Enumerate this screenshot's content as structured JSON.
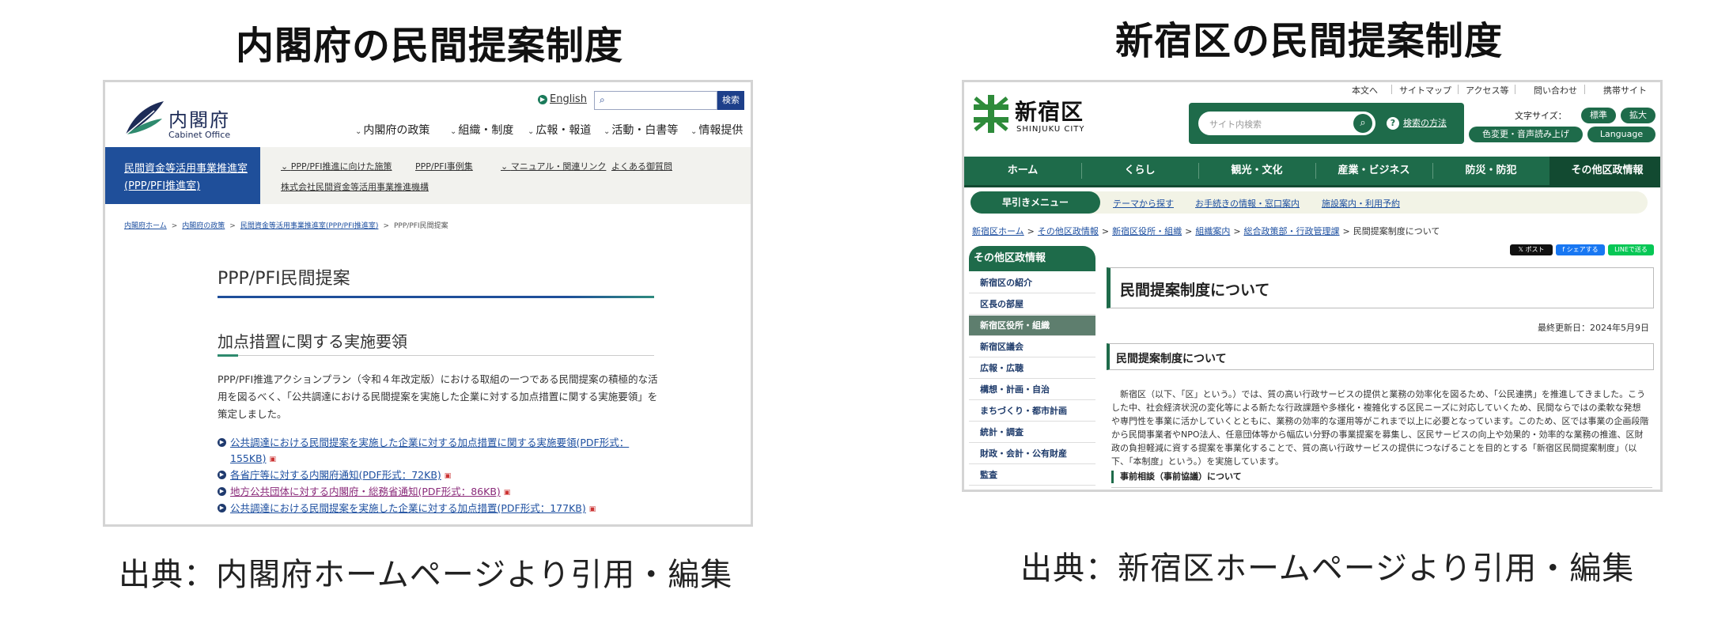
{
  "left": {
    "heading": "内閣府の民間提案制度",
    "caption": "出典：内閣府ホームページより引用・編集",
    "site": {
      "logo_ja": "内閣府",
      "logo_en": "Cabinet Office",
      "english_link": "English",
      "search_button": "検索",
      "global_nav": [
        "内閣府の政策",
        "組織・制度",
        "広報・報道",
        "活動・白書等",
        "情報提供"
      ],
      "subnav_active": [
        "民間資金等活用事業推進室",
        "(PPP/PFI推進室)"
      ],
      "subnav_links": [
        "PPP/PFI推進に向けた施策",
        "PPP/PFI事例集",
        "マニュアル・関連リンク",
        "よくある御質問",
        "株式会社民間資金等活用事業推進機構"
      ],
      "breadcrumb": [
        "内閣府ホーム",
        "内閣府の政策",
        "民間資金等活用事業推進室(PPP/PFI推進室)",
        "PPP/PFI民間提案"
      ],
      "page_title": "PPP/PFI民間提案",
      "section_title": "加点措置に関する実施要領",
      "body": "PPP/PFI推進アクションプラン（令和４年改定版）における取組の一つである民間提案の積極的な活用を図るべく、「公共調達における民間提案を実施した企業に対する加点措置に関する実施要領」を策定しました。",
      "documents": [
        "公共調達における民間提案を実施した企業に対する加点措置に関する実施要領(PDF形式：155KB)",
        "各省庁等に対する内閣府通知(PDF形式：72KB)",
        "地方公共団体に対する内閣府・総務省通知(PDF形式：86KB)",
        "公共調達における民間提案を実施した企業に対する加点措置(PDF形式：177KB)"
      ]
    }
  },
  "right": {
    "heading": "新宿区の民間提案制度",
    "caption": "出典：新宿区ホームページより引用・編集",
    "site": {
      "logo_ja": "新宿区",
      "logo_en": "SHINJUKU CITY",
      "utility_links": [
        "本文へ",
        "サイトマップ",
        "アクセス等",
        "問い合わせ",
        "携帯サイト"
      ],
      "search_placeholder": "サイト内検索",
      "search_help": "検索の方法",
      "font_size_label": "文字サイズ：",
      "font_buttons": [
        "標準",
        "拡大"
      ],
      "color_button": "色変更・音声読み上げ",
      "language_button": "Language",
      "global_nav": [
        "ホーム",
        "くらし",
        "観光・文化",
        "産業・ビジネス",
        "防災・防犯",
        "その他区政情報"
      ],
      "quick_menu_label": "早引きメニュー",
      "quick_links": [
        "テーマから探す",
        "お手続きの情報・窓口案内",
        "施設案内・利用予約"
      ],
      "breadcrumb": [
        "新宿区ホーム",
        "その他区政情報",
        "新宿区役所・組織",
        "組織案内",
        "総合政策部・行政管理課",
        "民間提案制度について"
      ],
      "share_buttons": [
        "ポスト",
        "シェアする",
        "LINEで送る"
      ],
      "side_heading": "その他区政情報",
      "side_items": [
        "新宿区の紹介",
        "区長の部屋",
        "新宿区役所・組織",
        "新宿区議会",
        "広報・広聴",
        "構想・計画・自治",
        "まちづくり・都市計画",
        "統計・調査",
        "財政・会計・公有財産",
        "監査"
      ],
      "page_title": "民間提案制度について",
      "last_updated": "最終更新日：2024年5月9日",
      "section_title": "民間提案制度について",
      "body": "新宿区（以下、「区」という。）では、質の高い行政サービスの提供と業務の効率化を図るため、「公民連携」を推進してきました。こうした中、社会経済状況の変化等による新たな行政課題や多様化・複雑化する区民ニーズに対応していくため、民間ならではの柔軟な発想や専門性を事業に活かしていくとともに、業務の効率的な運用等がこれまで以上に必要となっています。このため、区では事業の企画段階から民間事業者やNPO法人、任意団体等から幅広い分野の事業提案を募集し、区民サービスの向上や効果的・効率的な業務の推進、区財政の負担軽減に資する提案を事業化することで、質の高い行政サービスの提供につなげることを目的とする「新宿区民間提案制度」（以下、「本制度」という。）を実施しています。",
      "subsection_title": "事前相談（事前協議）について"
    }
  }
}
